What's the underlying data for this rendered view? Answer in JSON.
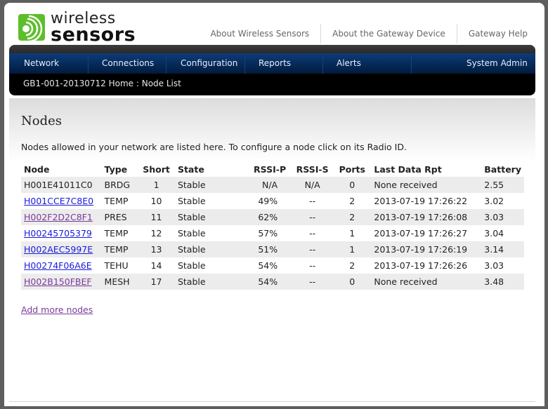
{
  "brand": {
    "line1": "wireless",
    "line2": "sensors",
    "color": "#5cbf2a"
  },
  "top_links": [
    {
      "label": "About Wireless Sensors"
    },
    {
      "label": "About the Gateway Device"
    },
    {
      "label": "Gateway Help"
    }
  ],
  "nav": {
    "items": [
      {
        "label": "Network"
      },
      {
        "label": "Connections"
      },
      {
        "label": "Configuration"
      },
      {
        "label": "Reports"
      },
      {
        "label": "Alerts"
      },
      {
        "label": "System Admin"
      }
    ],
    "breadcrumb": "GB1-001-20130712 Home : Node List"
  },
  "main": {
    "title": "Nodes",
    "intro": "Nodes allowed in your network are listed here. To configure a node click on its Radio ID.",
    "columns": [
      "Node",
      "Type",
      "Short",
      "State",
      "RSSI-P",
      "RSSI-S",
      "Ports",
      "Last Data Rpt",
      "Battery"
    ],
    "rows": [
      {
        "node": "H001E41011C0",
        "link": "none",
        "type": "BRDG",
        "short": "1",
        "state": "Stable",
        "rssi_p": "N/A",
        "rssi_s": "N/A",
        "ports": "0",
        "last": "None received",
        "battery": "2.55"
      },
      {
        "node": "H001CCE7C8E0",
        "link": "link",
        "type": "TEMP",
        "short": "10",
        "state": "Stable",
        "rssi_p": "49%",
        "rssi_s": "--",
        "ports": "2",
        "last": "2013-07-19 17:26:22",
        "battery": "3.02"
      },
      {
        "node": "H002F2D2C8F1",
        "link": "visited",
        "type": "PRES",
        "short": "11",
        "state": "Stable",
        "rssi_p": "62%",
        "rssi_s": "--",
        "ports": "2",
        "last": "2013-07-19 17:26:08",
        "battery": "3.03"
      },
      {
        "node": "H00245705379",
        "link": "link",
        "type": "TEMP",
        "short": "12",
        "state": "Stable",
        "rssi_p": "57%",
        "rssi_s": "--",
        "ports": "1",
        "last": "2013-07-19 17:26:27",
        "battery": "3.04"
      },
      {
        "node": "H002AEC5997E",
        "link": "link",
        "type": "TEMP",
        "short": "13",
        "state": "Stable",
        "rssi_p": "51%",
        "rssi_s": "--",
        "ports": "1",
        "last": "2013-07-19 17:26:19",
        "battery": "3.14"
      },
      {
        "node": "H00274F06A6E",
        "link": "link",
        "type": "TEHU",
        "short": "14",
        "state": "Stable",
        "rssi_p": "54%",
        "rssi_s": "--",
        "ports": "2",
        "last": "2013-07-19 17:26:26",
        "battery": "3.03"
      },
      {
        "node": "H002B150FBEF",
        "link": "visited",
        "type": "MESH",
        "short": "17",
        "state": "Stable",
        "rssi_p": "54%",
        "rssi_s": "--",
        "ports": "0",
        "last": "None received",
        "battery": "3.48"
      }
    ],
    "add_more_label": "Add more nodes"
  },
  "colors": {
    "link": "#1a1adb",
    "visited": "#7a3a9a",
    "nav_blue": "#04254f"
  }
}
